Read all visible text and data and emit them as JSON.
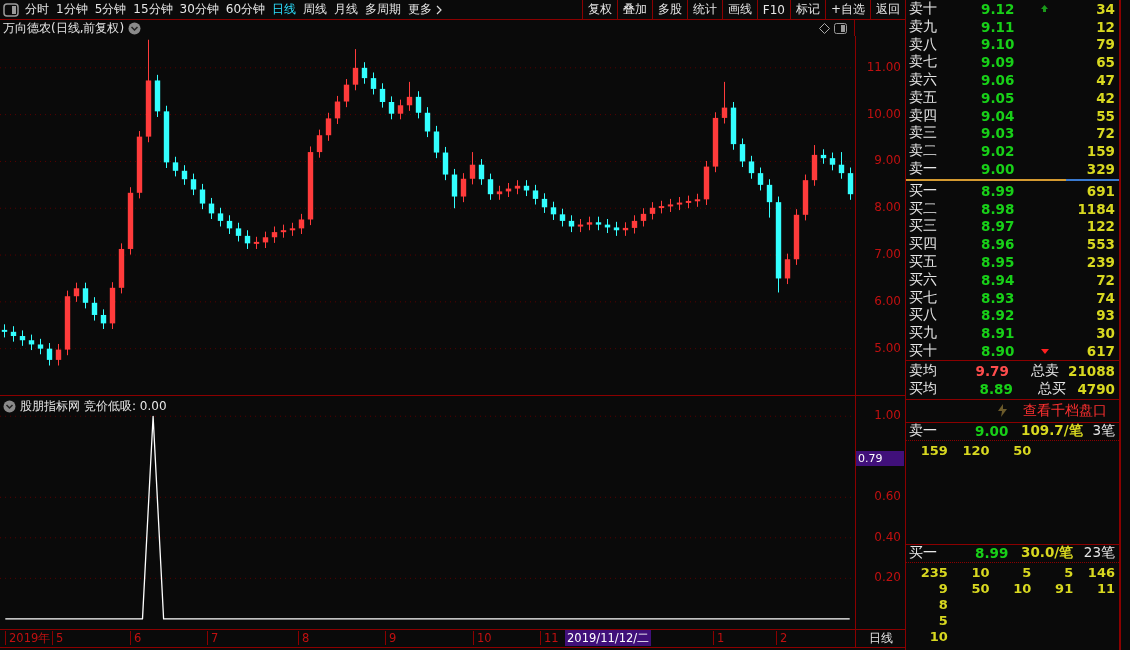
{
  "toolbar": {
    "periods": [
      {
        "label": "分时",
        "selected": false
      },
      {
        "label": "1分钟",
        "selected": false
      },
      {
        "label": "5分钟",
        "selected": false
      },
      {
        "label": "15分钟",
        "selected": false
      },
      {
        "label": "30分钟",
        "selected": false
      },
      {
        "label": "60分钟",
        "selected": false
      },
      {
        "label": "日线",
        "selected": true
      },
      {
        "label": "周线",
        "selected": false
      },
      {
        "label": "月线",
        "selected": false
      },
      {
        "label": "多周期",
        "selected": false
      }
    ],
    "more": "更多",
    "actions": [
      "复权",
      "叠加",
      "多股",
      "统计",
      "画线",
      "F10",
      "标记",
      "+自选",
      "返回"
    ]
  },
  "main_chart": {
    "title": "万向德农(日线,前复权)",
    "chart_data": {
      "type": "candlestick",
      "ylim": [
        4.01,
        11.68
      ],
      "grid": true,
      "yticks": [
        {
          "value": 11,
          "label": "11.00"
        },
        {
          "value": 10,
          "label": "10.00"
        },
        {
          "value": 9,
          "label": "9.00"
        },
        {
          "value": 8,
          "label": "8.00"
        },
        {
          "value": 7,
          "label": "7.00"
        },
        {
          "value": 6,
          "label": "6.00"
        },
        {
          "value": 5,
          "label": "5.00"
        }
      ],
      "categories": [
        null,
        null,
        null,
        null,
        null,
        null,
        null,
        null,
        null,
        null,
        null,
        null,
        null,
        null,
        null,
        null,
        null,
        null,
        null,
        null,
        null,
        null,
        null,
        null,
        null,
        null,
        null,
        null,
        null,
        null,
        null,
        null,
        null,
        null,
        null,
        null,
        null,
        null,
        null,
        null,
        null,
        null,
        null,
        null,
        null,
        null,
        null,
        null,
        null,
        null,
        null,
        null,
        null,
        null,
        null,
        null,
        null,
        null,
        null,
        null,
        null,
        null,
        null,
        null,
        null,
        null,
        null,
        null,
        null,
        null,
        null,
        null,
        null,
        null,
        null,
        null,
        null,
        null,
        null,
        null,
        null,
        null,
        null,
        null,
        null,
        null,
        null,
        null,
        null,
        null,
        null,
        null,
        null,
        null,
        null
      ],
      "ohlc": [
        [
          5.4,
          5.52,
          5.24,
          5.36
        ],
        [
          5.36,
          5.48,
          5.15,
          5.27
        ],
        [
          5.27,
          5.39,
          5.06,
          5.18
        ],
        [
          5.18,
          5.3,
          4.97,
          5.09
        ],
        [
          5.09,
          5.21,
          4.88,
          5.0
        ],
        [
          5.0,
          5.12,
          4.64,
          4.76
        ],
        [
          4.76,
          5.1,
          4.64,
          4.98
        ],
        [
          4.98,
          6.24,
          4.86,
          6.12
        ],
        [
          6.12,
          6.41,
          6.0,
          6.29
        ],
        [
          6.29,
          6.41,
          5.86,
          5.98
        ],
        [
          5.98,
          6.1,
          5.6,
          5.72
        ],
        [
          5.72,
          5.84,
          5.42,
          5.54
        ],
        [
          5.54,
          6.42,
          5.42,
          6.3
        ],
        [
          6.3,
          7.25,
          6.18,
          7.13
        ],
        [
          7.13,
          8.45,
          7.01,
          8.33
        ],
        [
          8.33,
          9.65,
          8.21,
          9.53
        ],
        [
          9.53,
          11.6,
          9.41,
          10.73
        ],
        [
          10.73,
          10.85,
          9.95,
          10.07
        ],
        [
          10.07,
          10.19,
          8.86,
          8.98
        ],
        [
          8.98,
          9.1,
          8.68,
          8.8
        ],
        [
          8.8,
          8.92,
          8.5,
          8.62
        ],
        [
          8.62,
          8.74,
          8.28,
          8.4
        ],
        [
          8.4,
          8.52,
          7.98,
          8.1
        ],
        [
          8.1,
          8.22,
          7.77,
          7.89
        ],
        [
          7.89,
          8.01,
          7.61,
          7.73
        ],
        [
          7.73,
          7.85,
          7.45,
          7.57
        ],
        [
          7.57,
          7.69,
          7.29,
          7.41
        ],
        [
          7.41,
          7.53,
          7.13,
          7.25
        ],
        [
          7.25,
          7.39,
          7.13,
          7.27
        ],
        [
          7.27,
          7.5,
          7.15,
          7.38
        ],
        [
          7.38,
          7.61,
          7.26,
          7.49
        ],
        [
          7.49,
          7.65,
          7.37,
          7.53
        ],
        [
          7.53,
          7.69,
          7.41,
          7.57
        ],
        [
          7.57,
          7.88,
          7.45,
          7.76
        ],
        [
          7.76,
          9.32,
          7.64,
          9.2
        ],
        [
          9.2,
          9.68,
          9.08,
          9.56
        ],
        [
          9.56,
          10.04,
          9.44,
          9.92
        ],
        [
          9.92,
          10.4,
          9.8,
          10.28
        ],
        [
          10.28,
          10.76,
          10.16,
          10.64
        ],
        [
          10.64,
          11.4,
          10.52,
          11.0
        ],
        [
          11.0,
          11.12,
          10.66,
          10.78
        ],
        [
          10.78,
          10.9,
          10.43,
          10.55
        ],
        [
          10.55,
          10.67,
          10.15,
          10.27
        ],
        [
          10.27,
          10.39,
          9.9,
          10.02
        ],
        [
          10.02,
          10.32,
          9.9,
          10.2
        ],
        [
          10.2,
          10.7,
          10.08,
          10.38
        ],
        [
          10.38,
          10.5,
          9.92,
          10.04
        ],
        [
          10.04,
          10.16,
          9.52,
          9.64
        ],
        [
          9.64,
          9.76,
          9.07,
          9.19
        ],
        [
          9.19,
          9.31,
          8.6,
          8.72
        ],
        [
          8.72,
          8.84,
          8.0,
          8.25
        ],
        [
          8.25,
          8.75,
          8.13,
          8.63
        ],
        [
          8.63,
          9.2,
          8.51,
          8.93
        ],
        [
          8.93,
          9.05,
          8.5,
          8.62
        ],
        [
          8.62,
          8.74,
          8.18,
          8.3
        ],
        [
          8.3,
          8.48,
          8.18,
          8.36
        ],
        [
          8.36,
          8.54,
          8.24,
          8.42
        ],
        [
          8.42,
          8.6,
          8.3,
          8.48
        ],
        [
          8.48,
          8.6,
          8.26,
          8.38
        ],
        [
          8.38,
          8.5,
          8.08,
          8.2
        ],
        [
          8.2,
          8.32,
          7.9,
          8.02
        ],
        [
          8.02,
          8.14,
          7.75,
          7.87
        ],
        [
          7.87,
          7.99,
          7.61,
          7.73
        ],
        [
          7.73,
          7.85,
          7.49,
          7.61
        ],
        [
          7.61,
          7.77,
          7.49,
          7.65
        ],
        [
          7.65,
          7.82,
          7.53,
          7.7
        ],
        [
          7.7,
          7.82,
          7.53,
          7.65
        ],
        [
          7.65,
          7.77,
          7.47,
          7.59
        ],
        [
          7.59,
          7.71,
          7.41,
          7.53
        ],
        [
          7.53,
          7.7,
          7.41,
          7.58
        ],
        [
          7.58,
          7.85,
          7.46,
          7.73
        ],
        [
          7.73,
          8.0,
          7.61,
          7.88
        ],
        [
          7.88,
          8.13,
          7.76,
          8.01
        ],
        [
          8.01,
          8.16,
          7.89,
          8.04
        ],
        [
          8.04,
          8.2,
          7.92,
          8.08
        ],
        [
          8.08,
          8.24,
          7.96,
          8.12
        ],
        [
          8.12,
          8.27,
          8.0,
          8.15
        ],
        [
          8.15,
          8.31,
          8.03,
          8.19
        ],
        [
          8.19,
          9.01,
          8.07,
          8.89
        ],
        [
          8.89,
          10.05,
          8.77,
          9.93
        ],
        [
          9.93,
          10.7,
          9.81,
          10.15
        ],
        [
          10.15,
          10.27,
          9.25,
          9.37
        ],
        [
          9.37,
          9.49,
          8.88,
          9.0
        ],
        [
          9.0,
          9.12,
          8.63,
          8.75
        ],
        [
          8.75,
          8.87,
          8.38,
          8.5
        ],
        [
          8.5,
          8.62,
          7.8,
          8.13
        ],
        [
          8.13,
          8.25,
          6.2,
          6.5
        ],
        [
          6.5,
          7.03,
          6.38,
          6.91
        ],
        [
          6.91,
          7.98,
          6.79,
          7.86
        ],
        [
          7.86,
          8.72,
          7.74,
          8.6
        ],
        [
          8.6,
          9.35,
          8.48,
          9.14
        ],
        [
          9.14,
          9.26,
          8.95,
          9.07
        ],
        [
          9.07,
          9.19,
          8.81,
          8.93
        ],
        [
          8.93,
          9.2,
          8.63,
          8.75
        ],
        [
          8.75,
          8.87,
          8.18,
          8.3
        ]
      ]
    }
  },
  "indicator": {
    "name": "股朋指标网",
    "reading": "竞价低吸: 0.00",
    "current_tag": "0.79",
    "chart_data": {
      "type": "line",
      "ylim": [
        -0.05,
        1.1
      ],
      "grid": true,
      "categories": [
        null,
        null,
        null,
        null,
        null,
        null,
        null,
        null,
        null,
        null,
        null,
        null,
        null,
        null,
        null,
        null,
        null,
        null,
        null,
        null,
        null,
        null,
        null,
        null,
        null,
        null,
        null,
        null,
        null,
        null,
        null,
        null,
        null,
        null,
        null,
        null,
        null,
        null,
        null,
        null,
        null,
        null,
        null,
        null,
        null,
        null,
        null,
        null,
        null,
        null,
        null,
        null,
        null,
        null,
        null,
        null,
        null,
        null,
        null,
        null,
        null,
        null,
        null,
        null,
        null,
        null,
        null,
        null,
        null,
        null,
        null,
        null,
        null,
        null,
        null,
        null,
        null,
        null,
        null,
        null,
        null
      ],
      "series": [
        {
          "color": "#ffffff",
          "values": [
            0,
            0,
            0,
            0,
            0,
            0,
            0,
            0,
            0,
            0,
            0,
            0,
            0,
            0,
            1,
            0,
            0,
            0,
            0,
            0,
            0,
            0,
            0,
            0,
            0,
            0,
            0,
            0,
            0,
            0,
            0,
            0,
            0,
            0,
            0,
            0,
            0,
            0,
            0,
            0,
            0,
            0,
            0,
            0,
            0,
            0,
            0,
            0,
            0,
            0,
            0,
            0,
            0,
            0,
            0,
            0,
            0,
            0,
            0,
            0,
            0,
            0,
            0,
            0,
            0,
            0,
            0,
            0,
            0,
            0,
            0,
            0,
            0,
            0,
            0,
            0,
            0,
            0,
            0,
            0,
            0
          ]
        }
      ],
      "yticks": [
        {
          "value": 0.2,
          "label": "0.20"
        },
        {
          "value": 0.4,
          "label": "0.40"
        },
        {
          "value": 0.6,
          "label": "0.60"
        },
        {
          "value": 1.0,
          "label": "1.00"
        }
      ]
    }
  },
  "time_axis": {
    "labels": [
      "2019年",
      "5",
      "6",
      "7",
      "8",
      "9",
      "10",
      "11",
      "1",
      "2"
    ],
    "cursor_date": "2019/11/12/二",
    "period": "日线"
  },
  "order_book": {
    "asks": [
      {
        "label": "卖十",
        "price": "9.12",
        "volume": "34",
        "flagged": true
      },
      {
        "label": "卖九",
        "price": "9.11",
        "volume": "12",
        "flagged": false
      },
      {
        "label": "卖八",
        "price": "9.10",
        "volume": "79",
        "flagged": false
      },
      {
        "label": "卖七",
        "price": "9.09",
        "volume": "65",
        "flagged": false
      },
      {
        "label": "卖六",
        "price": "9.06",
        "volume": "47",
        "flagged": false
      },
      {
        "label": "卖五",
        "price": "9.05",
        "volume": "42",
        "flagged": false
      },
      {
        "label": "卖四",
        "price": "9.04",
        "volume": "55",
        "flagged": false
      },
      {
        "label": "卖三",
        "price": "9.03",
        "volume": "72",
        "flagged": false
      },
      {
        "label": "卖二",
        "price": "9.02",
        "volume": "159",
        "flagged": false
      },
      {
        "label": "卖一",
        "price": "9.00",
        "volume": "329",
        "flagged": false
      }
    ],
    "bids": [
      {
        "label": "买一",
        "price": "8.99",
        "volume": "691",
        "flagged": false
      },
      {
        "label": "买二",
        "price": "8.98",
        "volume": "1184",
        "flagged": false
      },
      {
        "label": "买三",
        "price": "8.97",
        "volume": "122",
        "flagged": false
      },
      {
        "label": "买四",
        "price": "8.96",
        "volume": "553",
        "flagged": false
      },
      {
        "label": "买五",
        "price": "8.95",
        "volume": "239",
        "flagged": false
      },
      {
        "label": "买六",
        "price": "8.94",
        "volume": "72",
        "flagged": false
      },
      {
        "label": "买七",
        "price": "8.93",
        "volume": "74",
        "flagged": false
      },
      {
        "label": "买八",
        "price": "8.92",
        "volume": "93",
        "flagged": false
      },
      {
        "label": "买九",
        "price": "8.91",
        "volume": "30",
        "flagged": false
      },
      {
        "label": "买十",
        "price": "8.90",
        "volume": "617",
        "flagged": true
      }
    ],
    "averages": [
      {
        "label": "卖均",
        "price": "9.79",
        "color": "#ff4d4d",
        "total_label": "总卖",
        "total": "21088"
      },
      {
        "label": "买均",
        "price": "8.89",
        "color": "#18d018",
        "total_label": "总买",
        "total": "4790"
      }
    ]
  },
  "depth_link": "查看千档盘口",
  "queues": [
    {
      "label": "卖一",
      "price": "9.00",
      "per_order": "109.7/笔",
      "orders": "3笔",
      "rows": [
        [
          "159",
          "120",
          "50"
        ]
      ]
    },
    {
      "label": "买一",
      "price": "8.99",
      "per_order": "30.0/笔",
      "orders": "23笔",
      "rows": [
        [
          "235",
          "10",
          "5",
          "5",
          "146"
        ],
        [
          "9",
          "50",
          "10",
          "91",
          "11"
        ],
        [
          "8"
        ],
        [
          "5"
        ],
        [
          "10"
        ]
      ]
    }
  ]
}
